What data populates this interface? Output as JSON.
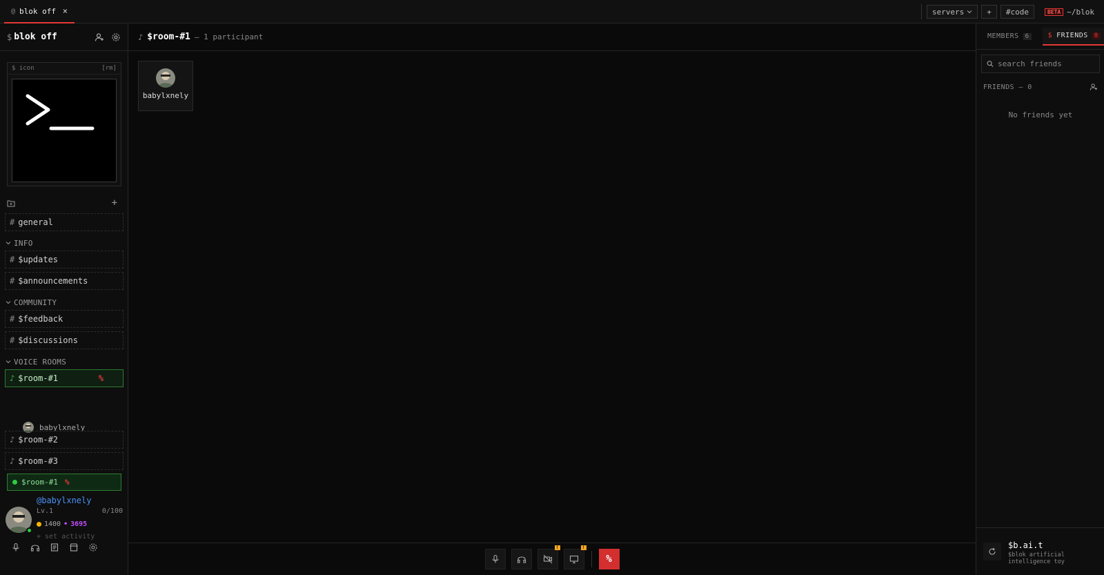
{
  "tab": {
    "prefix": "@",
    "title": "blok off",
    "close": "×"
  },
  "topbar": {
    "servers_label": "servers",
    "plus_label": "+",
    "code_label": "#code",
    "beta_label": "BETA",
    "path_label": "~/blok"
  },
  "server": {
    "dollar": "$",
    "name": "blok off"
  },
  "iconbox": {
    "label": "$ icon",
    "remove": "[rm]"
  },
  "channels": {
    "general": "general",
    "categories": [
      {
        "name": "INFO",
        "items": [
          "$updates",
          "$announcements"
        ]
      },
      {
        "name": "COMMUNITY",
        "items": [
          "$feedback",
          "$discussions"
        ]
      },
      {
        "name": "VOICE ROOMS",
        "items": [
          "$room-#1",
          "$room-#2",
          "$room-#3"
        ]
      }
    ],
    "text_prefix": "#",
    "voice_prefix": "♪",
    "hangup_glyph": "%"
  },
  "voice_user": "babylxnely",
  "voice_bar": {
    "room": "$room-#1",
    "hangup": "%"
  },
  "user": {
    "handle": "@babylxnely",
    "level": "Lv.1",
    "xp": "0/100",
    "coins": "1400",
    "gem_sep": "•",
    "gems": "3695",
    "activity": "+ set activity"
  },
  "main": {
    "note": "♪",
    "room": "$room-#1",
    "participants": "— 1 participant",
    "tile_name": "babylxnely",
    "warn_glyph": "!",
    "hangup": "%"
  },
  "right": {
    "members_label": "MEMBERS",
    "members_count": "6",
    "friends_prefix": "$",
    "friends_label": "FRIENDS",
    "friends_count": "0",
    "search_placeholder": "search friends",
    "friends_header": "FRIENDS — 0",
    "empty": "No friends yet",
    "bait_title": "$b.ai.t",
    "bait_sub": "$blok artificial intelligence toy"
  },
  "colors": {
    "accent": "#e53935",
    "online": "#2ecc40",
    "link": "#4a90f5",
    "gem": "#c04df9",
    "coin": "#f5b301"
  }
}
